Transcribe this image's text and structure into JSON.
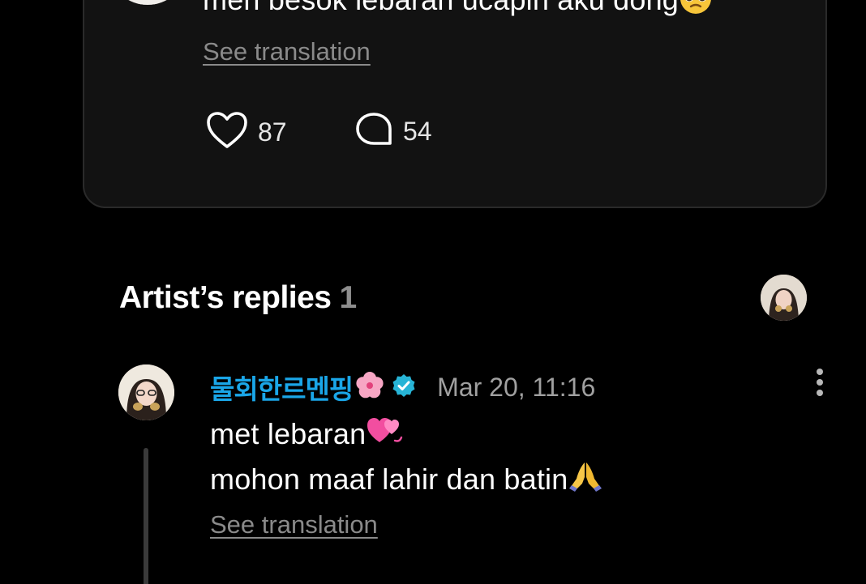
{
  "post": {
    "text": "men besok lebaran ucapin aku dong",
    "text_emoji": "pleading-face-emoji",
    "see_translation": "See translation",
    "likes": "87",
    "comments": "54"
  },
  "replies_section": {
    "title": "Artist’s replies",
    "count": "1"
  },
  "reply": {
    "author": "물회한르멘핑",
    "author_emoji": "cherry-blossom-emoji",
    "verified": true,
    "date": "Mar 20, 11:16",
    "line1": "met lebaran",
    "line1_emoji": "two-hearts-emoji",
    "line2": "mohon maaf lahir dan batin",
    "line2_emoji": "folded-hands-emoji",
    "see_translation": "See translation"
  },
  "colors": {
    "background": "#000000",
    "card": "#121212",
    "accent": "#1aa6e8",
    "muted": "#8a8a8a"
  }
}
